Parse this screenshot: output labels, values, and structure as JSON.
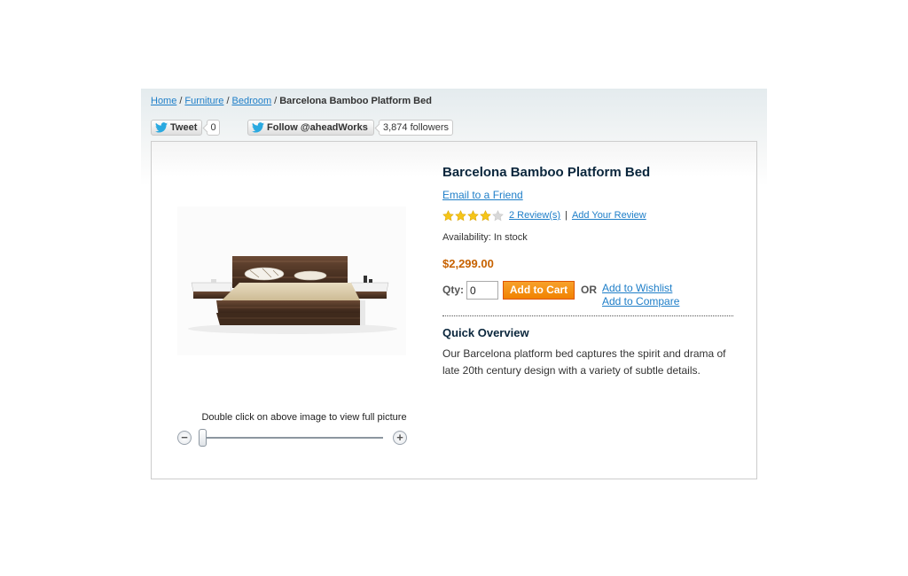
{
  "breadcrumb": {
    "items": [
      "Home",
      "Furniture",
      "Bedroom"
    ],
    "separator": "/",
    "current": "Barcelona Bamboo Platform Bed"
  },
  "social": {
    "tweet_label": "Tweet",
    "tweet_count": "0",
    "follow_label": "Follow @aheadWorks",
    "followers_count": "3,874 followers"
  },
  "product": {
    "name": "Barcelona Bamboo Platform Bed",
    "email_friend": "Email to a Friend",
    "rating_stars": 4,
    "rating_max": 5,
    "reviews_link": "2 Review(s)",
    "rating_separator": "|",
    "add_review": "Add Your Review",
    "availability": "Availability: In stock",
    "price": "$2,299.00",
    "qty_label": "Qty:",
    "qty_value": "0",
    "add_to_cart": "Add to Cart",
    "or_label": "OR",
    "add_to_wishlist": "Add to Wishlist",
    "add_to_compare": "Add to Compare"
  },
  "image": {
    "zoom_hint": "Double click on above image to view  full picture",
    "zoom_out_symbol": "−",
    "zoom_in_symbol": "+"
  },
  "overview": {
    "title": "Quick Overview",
    "text": "Our Barcelona platform bed captures the spirit and drama of late 20th century design with a variety of subtle details."
  },
  "colors": {
    "link": "#1e7ec8",
    "price": "#c76200",
    "cart_button": "#f18200",
    "star_filled": "#f5c518",
    "star_empty": "#d8d8d8",
    "twitter": "#2aa9e0"
  }
}
